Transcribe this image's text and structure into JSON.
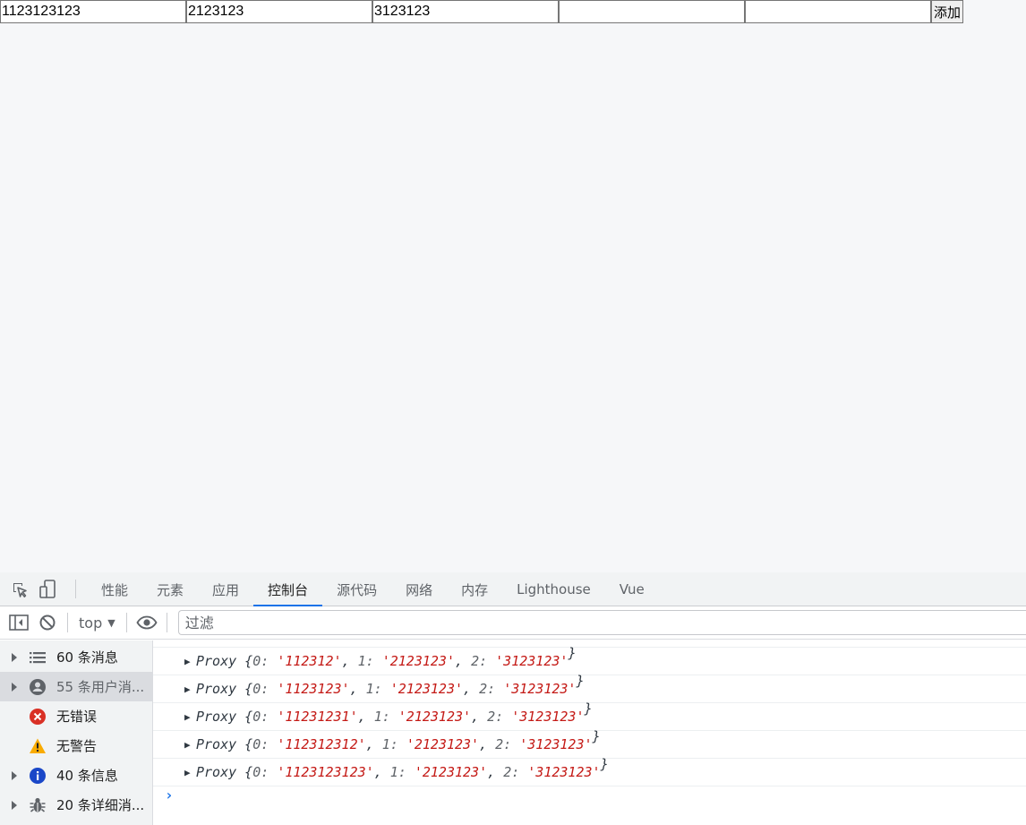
{
  "form": {
    "inputs": [
      "1123123123",
      "2123123",
      "3123123",
      "",
      ""
    ],
    "add_button": "添加"
  },
  "devtools": {
    "tabs": [
      {
        "label": "性能",
        "active": false
      },
      {
        "label": "元素",
        "active": false
      },
      {
        "label": "应用",
        "active": false
      },
      {
        "label": "控制台",
        "active": true
      },
      {
        "label": "源代码",
        "active": false
      },
      {
        "label": "网络",
        "active": false
      },
      {
        "label": "内存",
        "active": false
      },
      {
        "label": "Lighthouse",
        "active": false
      },
      {
        "label": "Vue",
        "active": false
      }
    ],
    "toolbar": {
      "context": "top",
      "filter_placeholder": "过滤"
    },
    "sidebar": [
      {
        "label": "60 条消息",
        "icon": "list-icon",
        "expandable": true,
        "selected": false
      },
      {
        "label": "55 条用户消...",
        "icon": "user-icon",
        "expandable": true,
        "selected": true
      },
      {
        "label": "无错误",
        "icon": "error-icon",
        "expandable": false,
        "selected": false
      },
      {
        "label": "无警告",
        "icon": "warning-icon",
        "expandable": false,
        "selected": false
      },
      {
        "label": "40 条信息",
        "icon": "info-icon",
        "expandable": true,
        "selected": false
      },
      {
        "label": "20 条详细消...",
        "icon": "bug-icon",
        "expandable": true,
        "selected": false
      }
    ],
    "logs": [
      {
        "prefix": "Proxy",
        "v0": "'112312'",
        "v1": "'2123123'",
        "v2": "'3123123'"
      },
      {
        "prefix": "Proxy",
        "v0": "'1123123'",
        "v1": "'2123123'",
        "v2": "'3123123'"
      },
      {
        "prefix": "Proxy",
        "v0": "'11231231'",
        "v1": "'2123123'",
        "v2": "'3123123'"
      },
      {
        "prefix": "Proxy",
        "v0": "'112312312'",
        "v1": "'2123123'",
        "v2": "'3123123'"
      },
      {
        "prefix": "Proxy",
        "v0": "'1123123123'",
        "v1": "'2123123'",
        "v2": "'3123123'"
      }
    ],
    "colors": {
      "accent": "#1a73e8",
      "string": "#c41a16",
      "error": "#d93025",
      "warning": "#f9ab00",
      "info": "#1a47c8"
    }
  }
}
